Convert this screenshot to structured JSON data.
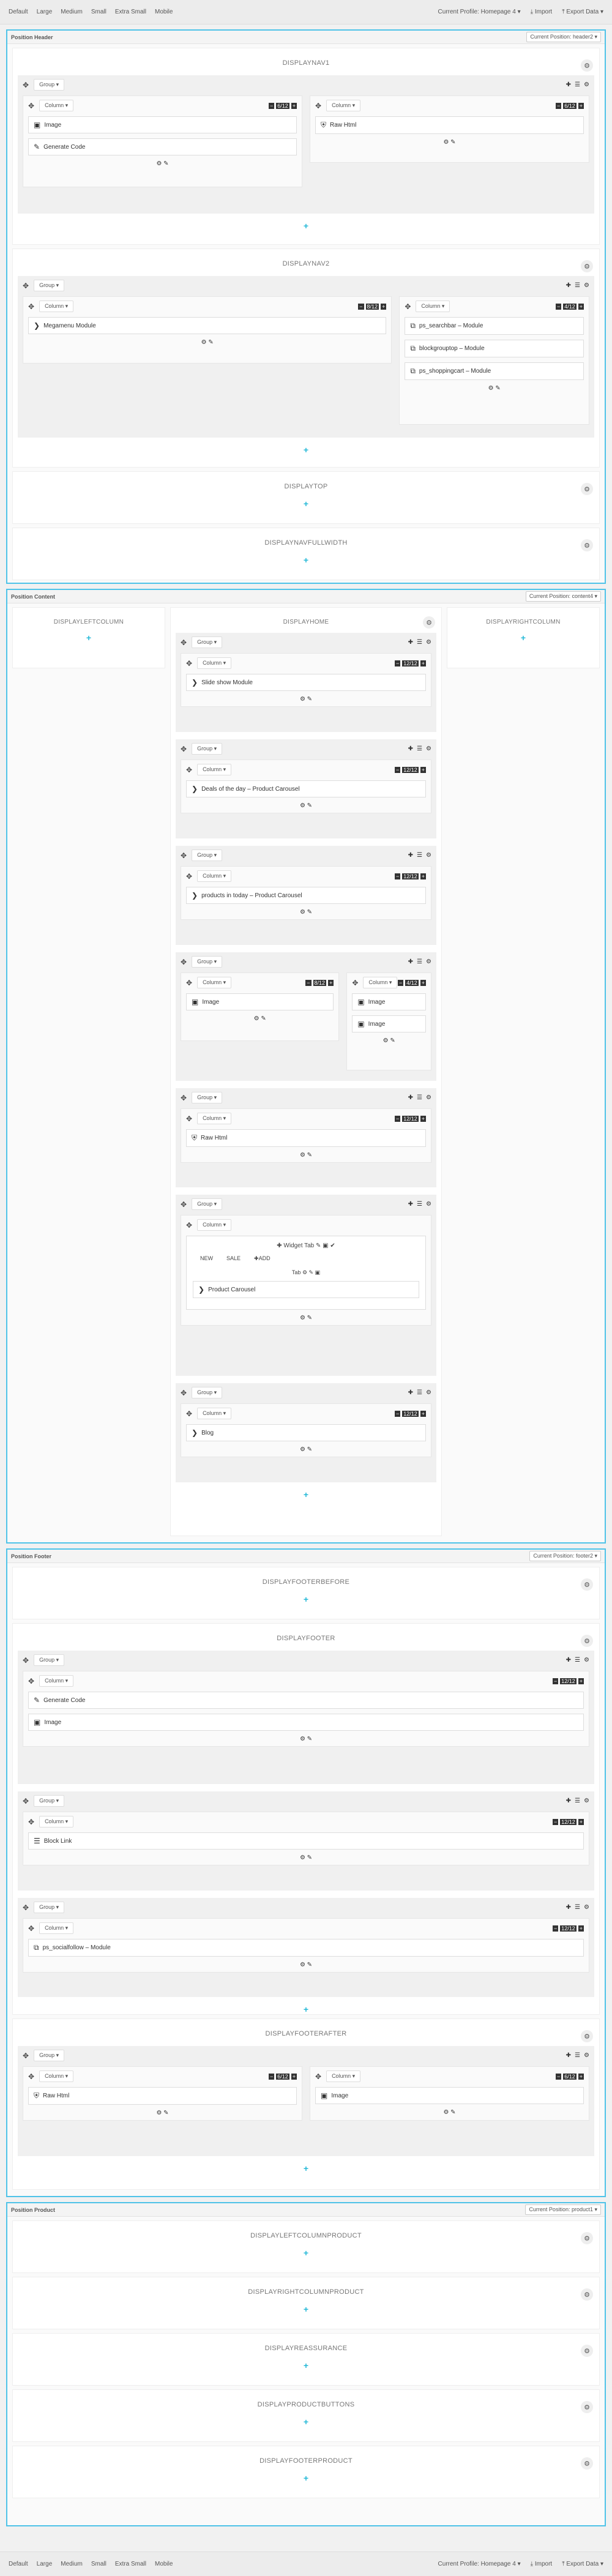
{
  "toolbar": {
    "devices": [
      "Default",
      "Large",
      "Medium",
      "Small",
      "Extra Small",
      "Mobile"
    ],
    "profile": "Current Profile: Homepage 4 ▾",
    "import": "Import",
    "export": "Export Data ▾"
  },
  "labels": {
    "group": "Group ▾",
    "column": "Column ▾",
    "tab": "Tab"
  },
  "header": {
    "title": "Position Header",
    "position_select": "Current Position: header2 ▾",
    "hooks": {
      "displaynav": "DISPLAYNAV1",
      "displaynav2": "DISPLAYNAV2",
      "displaytop": "DISPLAYTOP",
      "displaynavfull": "DISPLAYNAVFULLWIDTH"
    },
    "modules": {
      "image": "Image",
      "generate_code": "Generate Code",
      "raw_html": "Raw Html",
      "megamenu": "Megamenu Module",
      "searchbar": "ps_searchbar – Module",
      "blockgrouptop": "blockgrouptop – Module",
      "shoppingcart": "ps_shoppingcart – Module"
    }
  },
  "content": {
    "title": "Position Content",
    "position_select": "Current Position: content4 ▾",
    "hooks": {
      "left": "DISPLAYLEFTCOLUMN",
      "home": "DISPLAYHOME",
      "right": "DISPLAYRIGHTCOLUMN"
    },
    "modules": {
      "slideshow": "Slide show Module",
      "deals": "Deals of the day – Product Carousel",
      "products_today": "products in today – Product Carousel",
      "image": "Image",
      "raw_html": "Raw Html",
      "widget_tab": "Widget Tab",
      "tabs": [
        "NEW",
        "SALE",
        "ADD"
      ],
      "product_carousel": "Product Carousel",
      "blog": "Blog"
    }
  },
  "footer": {
    "title": "Position Footer",
    "position_select": "Current Position: footer2 ▾",
    "hooks": {
      "before": "DISPLAYFOOTERBEFORE",
      "footer": "DISPLAYFOOTER",
      "after": "DISPLAYFOOTERAFTER"
    },
    "modules": {
      "generate_code": "Generate Code",
      "image": "Image",
      "block_link": "Block Link",
      "socialfollow": "ps_socialfollow – Module",
      "raw_html": "Raw Html"
    }
  },
  "product": {
    "title": "Position Product",
    "position_select": "Current Position: product1 ▾",
    "hooks": [
      "DISPLAYLEFTCOLUMNPRODUCT",
      "DISPLAYRIGHTCOLUMNPRODUCT",
      "DISPLAYREASSURANCE",
      "DISPLAYPRODUCTBUTTONS",
      "DISPLAYFOOTERPRODUCT"
    ]
  }
}
